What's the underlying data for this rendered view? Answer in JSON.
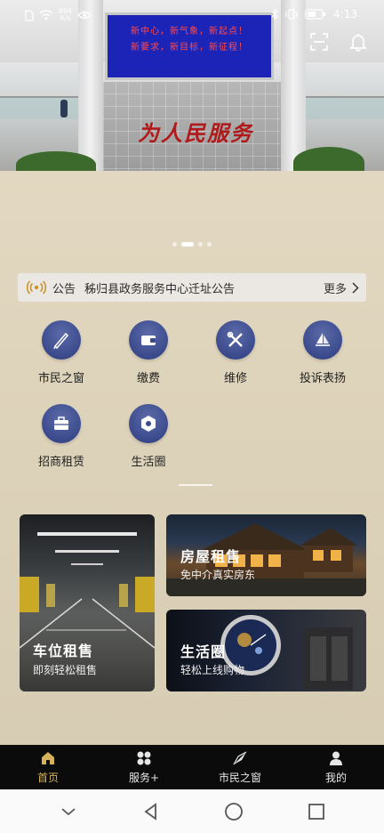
{
  "status_bar": {
    "net_speed_value": "694",
    "net_speed_unit": "K/s",
    "time": "4:13"
  },
  "banner": {
    "screen_line1": "新中心，新气象，新起点！",
    "screen_line2": "新要求，新目标，新征程！",
    "calligraphy": "为人民服务",
    "carousel_pages": 4,
    "carousel_active": 1
  },
  "notice": {
    "tag": "公告",
    "text": "秭归县政务服务中心迁址公告",
    "more_label": "更多"
  },
  "services": [
    {
      "label": "市民之窗",
      "icon": "pen-nib-icon"
    },
    {
      "label": "缴费",
      "icon": "wallet-icon"
    },
    {
      "label": "维修",
      "icon": "tools-icon"
    },
    {
      "label": "投诉表扬",
      "icon": "sailboat-icon"
    },
    {
      "label": "招商租赁",
      "icon": "briefcase-icon"
    },
    {
      "label": "生活圈",
      "icon": "hexagon-icon"
    }
  ],
  "cards": {
    "parking": {
      "title": "车位租售",
      "subtitle": "即刻轻松租售"
    },
    "house": {
      "title": "房屋租售",
      "subtitle": "免中介真实房东"
    },
    "life": {
      "title": "生活圈",
      "subtitle": "轻松上线购物"
    }
  },
  "tabbar": [
    {
      "label": "首页",
      "icon": "home-icon",
      "active": true
    },
    {
      "label": "服务+",
      "icon": "clover-icon",
      "active": false
    },
    {
      "label": "市民之窗",
      "icon": "compass-icon",
      "active": false
    },
    {
      "label": "我的",
      "icon": "user-icon",
      "active": false
    }
  ],
  "colors": {
    "accent": "#d6b25a",
    "icon_circle": "#3a4a8c",
    "tabbar_bg": "#0b0b0b"
  }
}
